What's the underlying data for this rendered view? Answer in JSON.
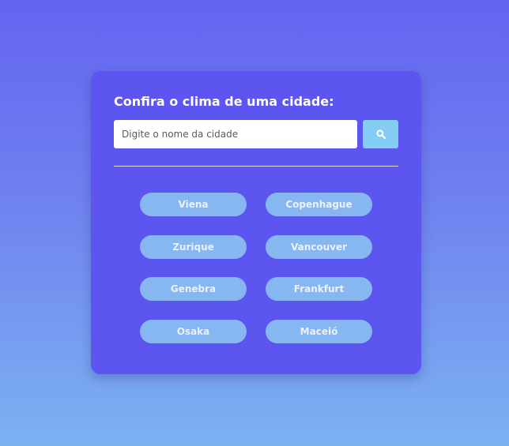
{
  "card": {
    "title": "Confira o clima de uma cidade:"
  },
  "search": {
    "placeholder": "Digite o nome da cidade",
    "value": "",
    "button_icon": "search-icon"
  },
  "cities": [
    {
      "label": "Viena"
    },
    {
      "label": "Copenhague"
    },
    {
      "label": "Zurique"
    },
    {
      "label": "Vancouver"
    },
    {
      "label": "Genebra"
    },
    {
      "label": "Frankfurt"
    },
    {
      "label": "Osaka"
    },
    {
      "label": "Maceió"
    }
  ],
  "colors": {
    "background_top": "#6464f1",
    "background_bottom": "#7cb2f2",
    "card": "#5d55ef",
    "search_button": "#86cdf3",
    "city_button": "#86b7f1",
    "text": "#ffffff"
  }
}
